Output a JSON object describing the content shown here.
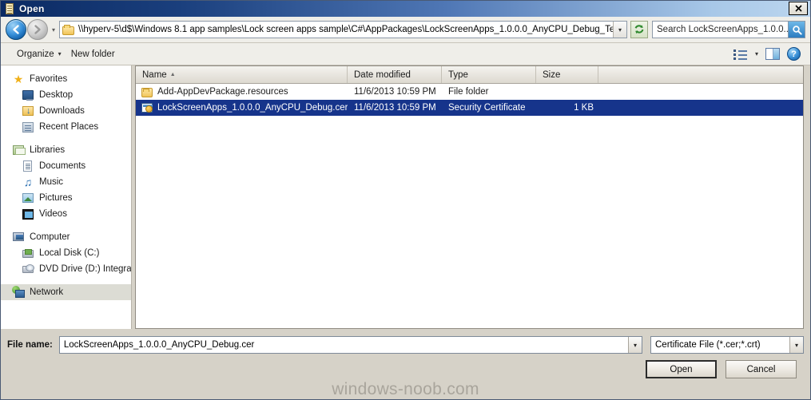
{
  "window": {
    "title": "Open",
    "title_icon": "certificate-scroll-icon",
    "close_label": "✕"
  },
  "address_bar": {
    "back_icon": "back-arrow-icon",
    "forward_icon": "forward-arrow-icon",
    "history_caret": "▾",
    "folder_icon": "folder-icon",
    "path": "\\\\hyperv-5\\d$\\Windows 8.1 app samples\\Lock screen apps sample\\C#\\AppPackages\\LockScreenApps_1.0.0.0_AnyCPU_Debug_Test",
    "dropdown_caret": "▾",
    "refresh_icon": "refresh-icon",
    "search_placeholder": "Search LockScreenApps_1.0.0...",
    "search_icon": "search-icon"
  },
  "toolbar": {
    "organize_label": "Organize",
    "organize_caret": "▾",
    "new_folder_label": "New folder",
    "view_icon": "list-view-icon",
    "view_caret": "▾",
    "preview_icon": "preview-pane-icon",
    "help_icon": "help-icon",
    "help_glyph": "?"
  },
  "sidebar": {
    "groups": [
      {
        "header": {
          "label": "Favorites",
          "icon": "star-icon"
        },
        "items": [
          {
            "label": "Desktop",
            "icon": "desktop-icon"
          },
          {
            "label": "Downloads",
            "icon": "downloads-folder-icon"
          },
          {
            "label": "Recent Places",
            "icon": "recent-places-icon"
          }
        ]
      },
      {
        "header": {
          "label": "Libraries",
          "icon": "libraries-icon"
        },
        "items": [
          {
            "label": "Documents",
            "icon": "document-icon"
          },
          {
            "label": "Music",
            "icon": "music-note-icon"
          },
          {
            "label": "Pictures",
            "icon": "pictures-icon"
          },
          {
            "label": "Videos",
            "icon": "videos-icon"
          }
        ]
      },
      {
        "header": {
          "label": "Computer",
          "icon": "computer-icon"
        },
        "items": [
          {
            "label": "Local Disk (C:)",
            "icon": "hard-disk-icon"
          },
          {
            "label": "DVD Drive (D:) Integra",
            "icon": "dvd-drive-icon"
          }
        ]
      }
    ],
    "network": {
      "label": "Network",
      "icon": "network-icon",
      "selected": true
    }
  },
  "file_list": {
    "columns": [
      {
        "key": "name",
        "label": "Name",
        "sorted": "asc",
        "sort_glyph": "▲"
      },
      {
        "key": "date",
        "label": "Date modified",
        "sorted": "",
        "sort_glyph": ""
      },
      {
        "key": "type",
        "label": "Type",
        "sorted": "",
        "sort_glyph": ""
      },
      {
        "key": "size",
        "label": "Size",
        "sorted": "",
        "sort_glyph": ""
      }
    ],
    "rows": [
      {
        "icon": "folder-icon",
        "name": "Add-AppDevPackage.resources",
        "date": "11/6/2013 10:59 PM",
        "type": "File folder",
        "size": "",
        "selected": false
      },
      {
        "icon": "security-certificate-icon",
        "name": "LockScreenApps_1.0.0.0_AnyCPU_Debug.cer",
        "date": "11/6/2013 10:59 PM",
        "type": "Security Certificate",
        "size": "1 KB",
        "selected": true
      }
    ]
  },
  "footer": {
    "file_name_label": "File name:",
    "file_name_value": "LockScreenApps_1.0.0.0_AnyCPU_Debug.cer",
    "file_name_caret": "▾",
    "filter_value": "Certificate File (*.cer;*.crt)",
    "filter_caret": "▾",
    "open_label": "Open",
    "cancel_label": "Cancel"
  },
  "watermark": {
    "text": "windows-noob.com"
  },
  "colors": {
    "selection_blue": "#16348b",
    "title_dark": "#0b2a63",
    "dialog_face": "#d6d2c8",
    "watermark_gray": "#a9a59c"
  }
}
